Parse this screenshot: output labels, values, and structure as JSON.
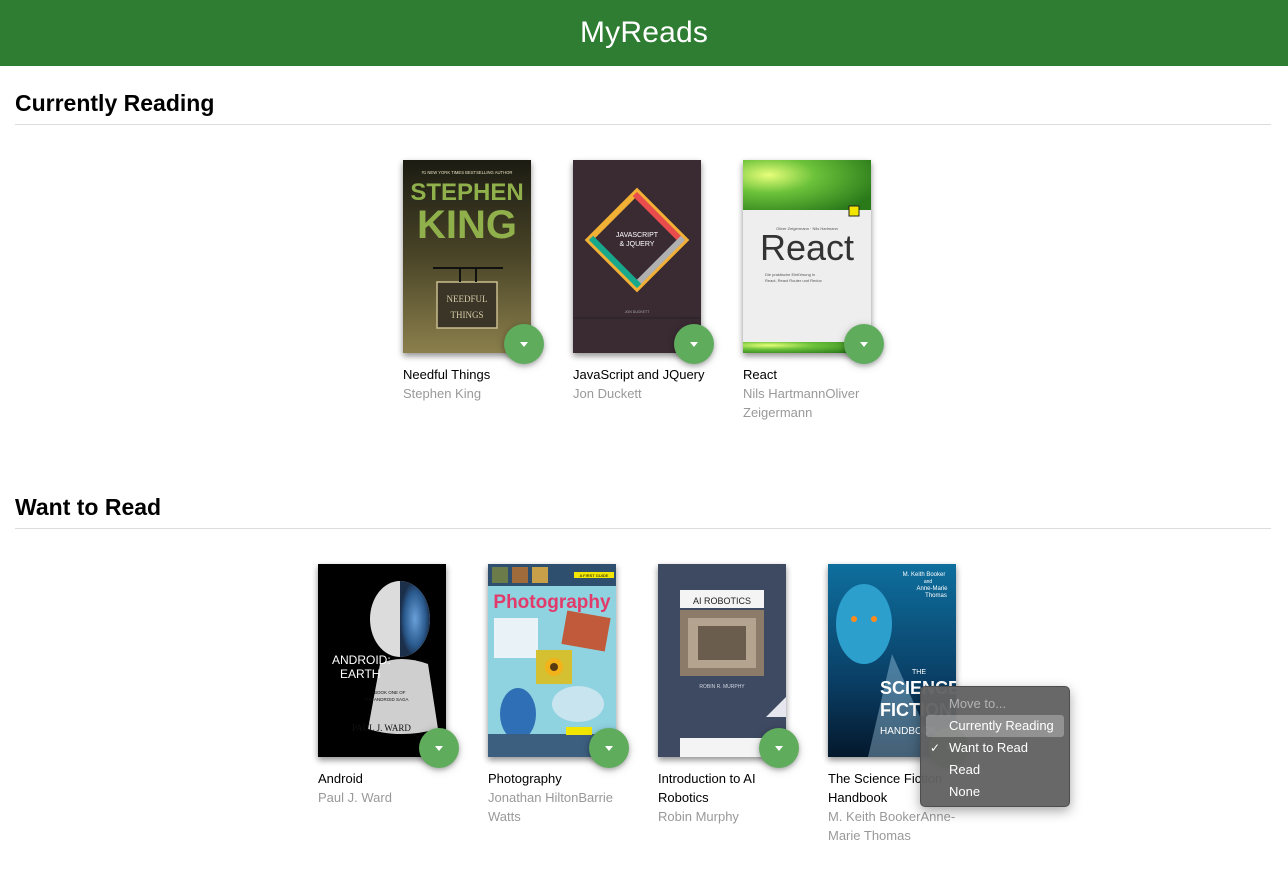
{
  "header": {
    "title": "MyReads"
  },
  "shelves": [
    {
      "title": "Currently Reading",
      "books": [
        {
          "title": "Needful Things",
          "authors": "Stephen King"
        },
        {
          "title": "JavaScript and JQuery",
          "authors": "Jon Duckett"
        },
        {
          "title": "React",
          "authors": "Nils HartmannOliver Zeigermann"
        }
      ]
    },
    {
      "title": "Want to Read",
      "books": [
        {
          "title": "Android",
          "authors": "Paul J. Ward"
        },
        {
          "title": "Photography",
          "authors": "Jonathan HiltonBarrie Watts"
        },
        {
          "title": "Introduction to AI Robotics",
          "authors": "Robin Murphy"
        },
        {
          "title": "The Science Fiction Handbook",
          "authors": "M. Keith BookerAnne-Marie Thomas"
        }
      ]
    }
  ],
  "covers": {
    "needful": {
      "line1": "#1 NEW YORK TIMES BESTSELLING AUTHOR",
      "author1": "STEPHEN",
      "author2": "KING",
      "title1": "NEEDFUL",
      "title2": "THINGS"
    },
    "jquery": {
      "line1": "JAVASCRIPT",
      "line2": "& JQUERY",
      "author": "JON DUCKETT"
    },
    "react": {
      "authors": "Oliver Zeigermann · Nils Hartmann",
      "title": "React",
      "sub1": "Die praktische Einführung in",
      "sub2": "React, React Router und Redux"
    },
    "android": {
      "title1": "ANDROID:",
      "title2": "EARTH",
      "sub1": "BOOK ONE OF",
      "sub2": "THE ANDROID SAGA",
      "author": "PAUL J. WARD"
    },
    "photo": {
      "badge": "A FIRST GUIDE",
      "title": "Photography"
    },
    "ai": {
      "title": "AI ROBOTICS",
      "author": "ROBIN R. MURPHY"
    },
    "scifi": {
      "authors1": "M. Keith Booker",
      "authors2": "and",
      "authors3": "Anne-Marie",
      "authors4": "Thomas",
      "title1": "SCIENCE",
      "title2": "FICTION",
      "title3": "HANDBOOK",
      "the": "THE"
    }
  },
  "dropdown": {
    "header": "Move to...",
    "options": [
      "Currently Reading",
      "Want to Read",
      "Read",
      "None"
    ],
    "selected": "Want to Read"
  },
  "colors": {
    "header_bg": "#2e7d32",
    "changer_button": "#60ac5d"
  }
}
